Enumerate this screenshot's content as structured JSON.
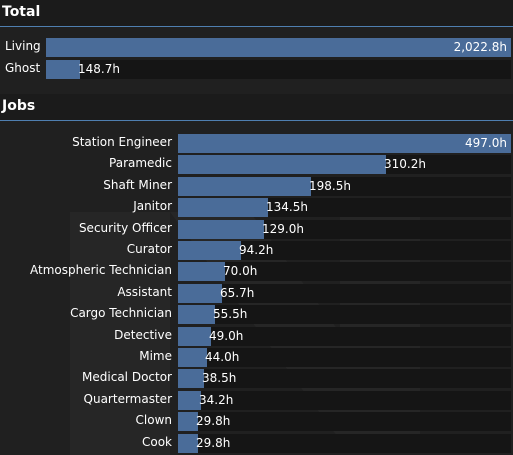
{
  "total": {
    "title": "Total",
    "max_hours": 2022.8,
    "rows": [
      {
        "label": "Living",
        "hours": 2022.8,
        "display": "2,022.8h"
      },
      {
        "label": "Ghost",
        "hours": 148.7,
        "display": "148.7h"
      }
    ]
  },
  "jobs": {
    "title": "Jobs",
    "max_hours": 497.0,
    "rows": [
      {
        "label": "Station Engineer",
        "hours": 497.0,
        "display": "497.0h"
      },
      {
        "label": "Paramedic",
        "hours": 310.2,
        "display": "310.2h"
      },
      {
        "label": "Shaft Miner",
        "hours": 198.5,
        "display": "198.5h"
      },
      {
        "label": "Janitor",
        "hours": 134.5,
        "display": "134.5h"
      },
      {
        "label": "Security Officer",
        "hours": 129.0,
        "display": "129.0h"
      },
      {
        "label": "Curator",
        "hours": 94.2,
        "display": "94.2h"
      },
      {
        "label": "Atmospheric Technician",
        "hours": 70.0,
        "display": "70.0h"
      },
      {
        "label": "Assistant",
        "hours": 65.7,
        "display": "65.7h"
      },
      {
        "label": "Cargo Technician",
        "hours": 55.5,
        "display": "55.5h"
      },
      {
        "label": "Detective",
        "hours": 49.0,
        "display": "49.0h"
      },
      {
        "label": "Mime",
        "hours": 44.0,
        "display": "44.0h"
      },
      {
        "label": "Medical Doctor",
        "hours": 38.5,
        "display": "38.5h"
      },
      {
        "label": "Quartermaster",
        "hours": 34.2,
        "display": "34.2h"
      },
      {
        "label": "Clown",
        "hours": 29.8,
        "display": "29.8h"
      },
      {
        "label": "Cook",
        "hours": 29.8,
        "display": "29.8h"
      }
    ]
  },
  "colors": {
    "background": "#202020",
    "header_background": "#1b1b1b",
    "header_divider": "#4f7fb0",
    "bar_fill": "#4a6c99",
    "bar_track": "#151515"
  }
}
